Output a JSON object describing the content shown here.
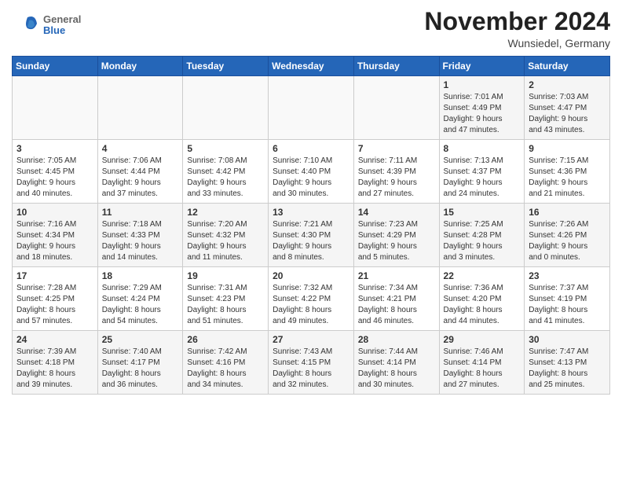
{
  "header": {
    "logo_general": "General",
    "logo_blue": "Blue",
    "month_title": "November 2024",
    "location": "Wunsiedel, Germany"
  },
  "weekdays": [
    "Sunday",
    "Monday",
    "Tuesday",
    "Wednesday",
    "Thursday",
    "Friday",
    "Saturday"
  ],
  "weeks": [
    [
      {
        "day": "",
        "info": ""
      },
      {
        "day": "",
        "info": ""
      },
      {
        "day": "",
        "info": ""
      },
      {
        "day": "",
        "info": ""
      },
      {
        "day": "",
        "info": ""
      },
      {
        "day": "1",
        "info": "Sunrise: 7:01 AM\nSunset: 4:49 PM\nDaylight: 9 hours\nand 47 minutes."
      },
      {
        "day": "2",
        "info": "Sunrise: 7:03 AM\nSunset: 4:47 PM\nDaylight: 9 hours\nand 43 minutes."
      }
    ],
    [
      {
        "day": "3",
        "info": "Sunrise: 7:05 AM\nSunset: 4:45 PM\nDaylight: 9 hours\nand 40 minutes."
      },
      {
        "day": "4",
        "info": "Sunrise: 7:06 AM\nSunset: 4:44 PM\nDaylight: 9 hours\nand 37 minutes."
      },
      {
        "day": "5",
        "info": "Sunrise: 7:08 AM\nSunset: 4:42 PM\nDaylight: 9 hours\nand 33 minutes."
      },
      {
        "day": "6",
        "info": "Sunrise: 7:10 AM\nSunset: 4:40 PM\nDaylight: 9 hours\nand 30 minutes."
      },
      {
        "day": "7",
        "info": "Sunrise: 7:11 AM\nSunset: 4:39 PM\nDaylight: 9 hours\nand 27 minutes."
      },
      {
        "day": "8",
        "info": "Sunrise: 7:13 AM\nSunset: 4:37 PM\nDaylight: 9 hours\nand 24 minutes."
      },
      {
        "day": "9",
        "info": "Sunrise: 7:15 AM\nSunset: 4:36 PM\nDaylight: 9 hours\nand 21 minutes."
      }
    ],
    [
      {
        "day": "10",
        "info": "Sunrise: 7:16 AM\nSunset: 4:34 PM\nDaylight: 9 hours\nand 18 minutes."
      },
      {
        "day": "11",
        "info": "Sunrise: 7:18 AM\nSunset: 4:33 PM\nDaylight: 9 hours\nand 14 minutes."
      },
      {
        "day": "12",
        "info": "Sunrise: 7:20 AM\nSunset: 4:32 PM\nDaylight: 9 hours\nand 11 minutes."
      },
      {
        "day": "13",
        "info": "Sunrise: 7:21 AM\nSunset: 4:30 PM\nDaylight: 9 hours\nand 8 minutes."
      },
      {
        "day": "14",
        "info": "Sunrise: 7:23 AM\nSunset: 4:29 PM\nDaylight: 9 hours\nand 5 minutes."
      },
      {
        "day": "15",
        "info": "Sunrise: 7:25 AM\nSunset: 4:28 PM\nDaylight: 9 hours\nand 3 minutes."
      },
      {
        "day": "16",
        "info": "Sunrise: 7:26 AM\nSunset: 4:26 PM\nDaylight: 9 hours\nand 0 minutes."
      }
    ],
    [
      {
        "day": "17",
        "info": "Sunrise: 7:28 AM\nSunset: 4:25 PM\nDaylight: 8 hours\nand 57 minutes."
      },
      {
        "day": "18",
        "info": "Sunrise: 7:29 AM\nSunset: 4:24 PM\nDaylight: 8 hours\nand 54 minutes."
      },
      {
        "day": "19",
        "info": "Sunrise: 7:31 AM\nSunset: 4:23 PM\nDaylight: 8 hours\nand 51 minutes."
      },
      {
        "day": "20",
        "info": "Sunrise: 7:32 AM\nSunset: 4:22 PM\nDaylight: 8 hours\nand 49 minutes."
      },
      {
        "day": "21",
        "info": "Sunrise: 7:34 AM\nSunset: 4:21 PM\nDaylight: 8 hours\nand 46 minutes."
      },
      {
        "day": "22",
        "info": "Sunrise: 7:36 AM\nSunset: 4:20 PM\nDaylight: 8 hours\nand 44 minutes."
      },
      {
        "day": "23",
        "info": "Sunrise: 7:37 AM\nSunset: 4:19 PM\nDaylight: 8 hours\nand 41 minutes."
      }
    ],
    [
      {
        "day": "24",
        "info": "Sunrise: 7:39 AM\nSunset: 4:18 PM\nDaylight: 8 hours\nand 39 minutes."
      },
      {
        "day": "25",
        "info": "Sunrise: 7:40 AM\nSunset: 4:17 PM\nDaylight: 8 hours\nand 36 minutes."
      },
      {
        "day": "26",
        "info": "Sunrise: 7:42 AM\nSunset: 4:16 PM\nDaylight: 8 hours\nand 34 minutes."
      },
      {
        "day": "27",
        "info": "Sunrise: 7:43 AM\nSunset: 4:15 PM\nDaylight: 8 hours\nand 32 minutes."
      },
      {
        "day": "28",
        "info": "Sunrise: 7:44 AM\nSunset: 4:14 PM\nDaylight: 8 hours\nand 30 minutes."
      },
      {
        "day": "29",
        "info": "Sunrise: 7:46 AM\nSunset: 4:14 PM\nDaylight: 8 hours\nand 27 minutes."
      },
      {
        "day": "30",
        "info": "Sunrise: 7:47 AM\nSunset: 4:13 PM\nDaylight: 8 hours\nand 25 minutes."
      }
    ]
  ]
}
